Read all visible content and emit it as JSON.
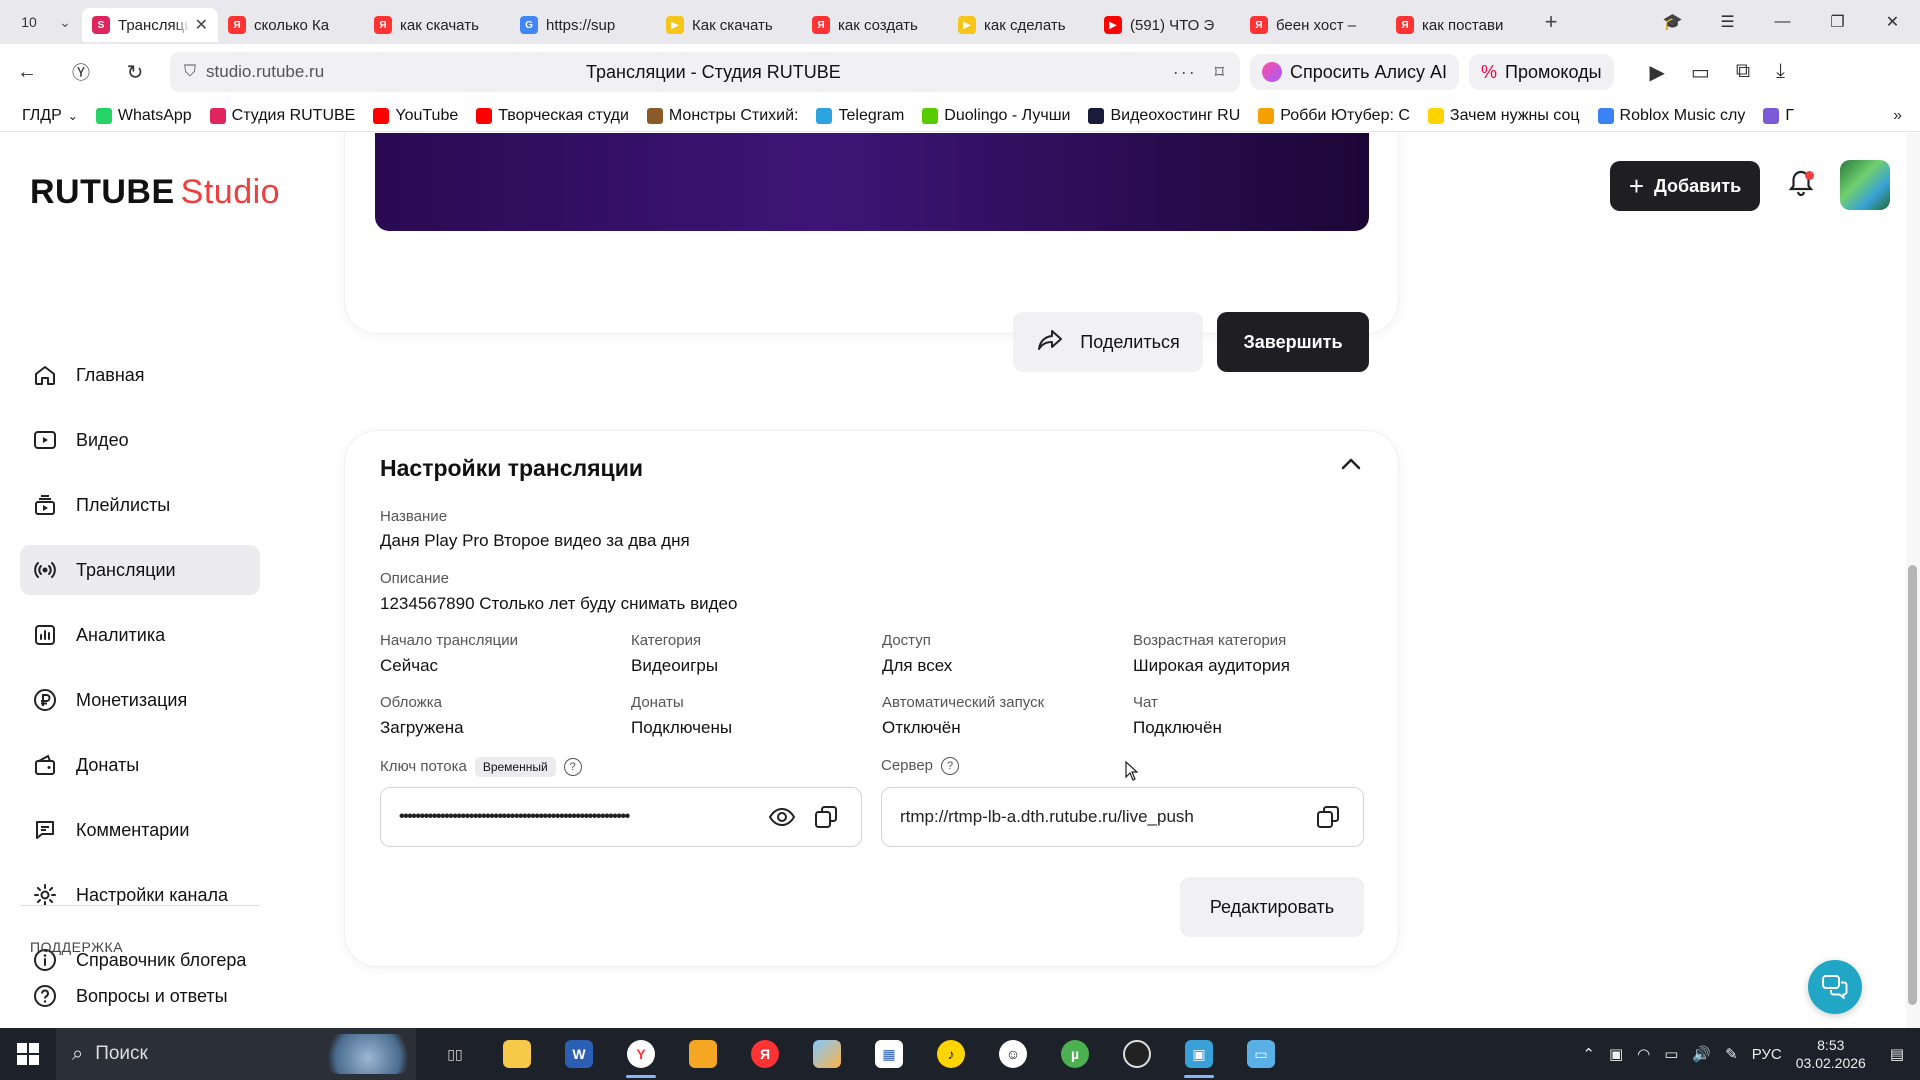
{
  "browser": {
    "tab_count": "10",
    "tabs": [
      {
        "label": "Трансляции",
        "color": "#e0245e",
        "glyph": "S",
        "active": true
      },
      {
        "label": "сколько Ка",
        "color": "#f33",
        "glyph": "Я"
      },
      {
        "label": "как скачать",
        "color": "#f33",
        "glyph": "Я"
      },
      {
        "label": "https://sup",
        "color": "#4285f4",
        "glyph": "G"
      },
      {
        "label": "Как скачать",
        "color": "#f5c518",
        "glyph": "▶"
      },
      {
        "label": "как создать",
        "color": "#f33",
        "glyph": "Я"
      },
      {
        "label": "как сделать",
        "color": "#f5c518",
        "glyph": "▶"
      },
      {
        "label": "(591) ЧТО Э",
        "color": "#f00",
        "glyph": "▶"
      },
      {
        "label": "беен хост –",
        "color": "#f33",
        "glyph": "Я"
      },
      {
        "label": "как постави",
        "color": "#f33",
        "glyph": "Я"
      }
    ],
    "url": "studio.rutube.ru",
    "page_title": "Трансляции - Студия RUTUBE",
    "alice_label": "Спросить Алису AI",
    "promo_label": "Промокоды",
    "bookmarks": [
      {
        "label": "ГЛДР",
        "color": "transparent"
      },
      {
        "label": "WhatsApp",
        "color": "#25d366"
      },
      {
        "label": "Студия RUTUBE",
        "color": "#e0245e"
      },
      {
        "label": "YouTube",
        "color": "#f00"
      },
      {
        "label": "Творческая студи",
        "color": "#f00"
      },
      {
        "label": "Монстры Стихий:",
        "color": "#8b5a2b"
      },
      {
        "label": "Telegram",
        "color": "#2aa3df"
      },
      {
        "label": "Duolingo - Лучши",
        "color": "#58cc02"
      },
      {
        "label": "Видеохостинг RU",
        "color": "#1a1a3a"
      },
      {
        "label": "Робби Ютубер: С",
        "color": "#f4a100"
      },
      {
        "label": "Зачем нужны соц",
        "color": "#ffd400"
      },
      {
        "label": "Roblox Music слу",
        "color": "#3b82f6"
      },
      {
        "label": "Г",
        "color": "#7c5cd6"
      }
    ]
  },
  "header": {
    "logo_main": "RUTUBE",
    "logo_sub": "Studio",
    "add_label": "Добавить"
  },
  "sidebar": {
    "items": [
      {
        "label": "Главная",
        "icon": "home-icon"
      },
      {
        "label": "Видео",
        "icon": "video-icon"
      },
      {
        "label": "Плейлисты",
        "icon": "playlist-icon"
      },
      {
        "label": "Трансляции",
        "icon": "broadcast-icon",
        "active": true
      },
      {
        "label": "Аналитика",
        "icon": "analytics-icon"
      },
      {
        "label": "Монетизация",
        "icon": "ruble-icon"
      },
      {
        "label": "Донаты",
        "icon": "donate-icon"
      },
      {
        "label": "Комментарии",
        "icon": "comment-icon"
      },
      {
        "label": "Настройки канала",
        "icon": "gear-icon"
      },
      {
        "label": "Справочник блогера",
        "icon": "info-icon"
      }
    ],
    "support_label": "ПОДДЕРЖКА",
    "faq_label": "Вопросы и ответы"
  },
  "actions": {
    "share_label": "Поделиться",
    "finish_label": "Завершить",
    "edit_label": "Редактировать"
  },
  "settings": {
    "title": "Настройки трансляции",
    "name_label": "Название",
    "name_value": "Даня Play Pro Второе видео за два дня",
    "desc_label": "Описание",
    "desc_value": "1234567890 Столько лет буду снимать видео",
    "grid": [
      {
        "label": "Начало трансляции",
        "value": "Сейчас"
      },
      {
        "label": "Категория",
        "value": "Видеоигры"
      },
      {
        "label": "Доступ",
        "value": "Для всех"
      },
      {
        "label": "Возрастная категория",
        "value": "Широкая аудитория"
      },
      {
        "label": "Обложка",
        "value": "Загружена"
      },
      {
        "label": "Донаты",
        "value": "Подключены"
      },
      {
        "label": "Автоматический запуск",
        "value": "Отключён"
      },
      {
        "label": "Чат",
        "value": "Подключён"
      }
    ],
    "key_label": "Ключ потока",
    "key_badge": "Временный",
    "key_mask": "••••••••••••••••••••••••••••••••••••••••••••••••••••••••",
    "server_label": "Сервер",
    "server_value": "rtmp://rtmp-lb-a.dth.rutube.ru/live_push"
  },
  "taskbar": {
    "search_placeholder": "Поиск",
    "lang": "РУС",
    "time": "8:53",
    "date": "03.02.2026"
  },
  "colors": {
    "accent": "#f03d3d",
    "dark_button": "#1f1f23",
    "fab": "#21a6c6"
  }
}
